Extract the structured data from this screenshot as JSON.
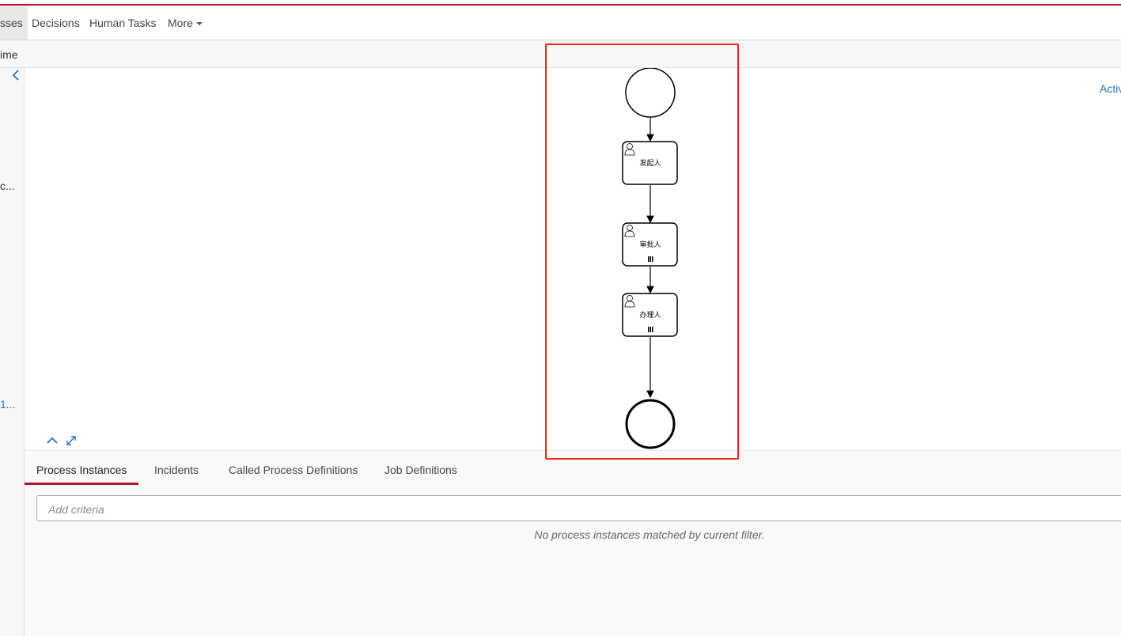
{
  "nav": {
    "items": [
      {
        "label": "sses",
        "active": true
      },
      {
        "label": "Decisions"
      },
      {
        "label": "Human Tasks"
      },
      {
        "label": "More"
      }
    ]
  },
  "breadcrumb": {
    "text": "ime"
  },
  "sidebar": {
    "truncated_1": "c...",
    "truncated_2": "1..."
  },
  "diagram": {
    "right_link": "Activ",
    "tasks": [
      {
        "label": "发起人",
        "multi_instance": false
      },
      {
        "label": "审批人",
        "multi_instance": true
      },
      {
        "label": "办理人",
        "multi_instance": true
      }
    ]
  },
  "tabs": [
    {
      "label": "Process Instances",
      "active": true
    },
    {
      "label": "Incidents"
    },
    {
      "label": "Called Process Definitions"
    },
    {
      "label": "Job Definitions"
    }
  ],
  "filter": {
    "placeholder": "Add criteria"
  },
  "empty_message": "No process instances matched by current filter.",
  "colors": {
    "accent": "#b5152b",
    "link": "#2c6fb7",
    "highlight": "#e8281e"
  }
}
